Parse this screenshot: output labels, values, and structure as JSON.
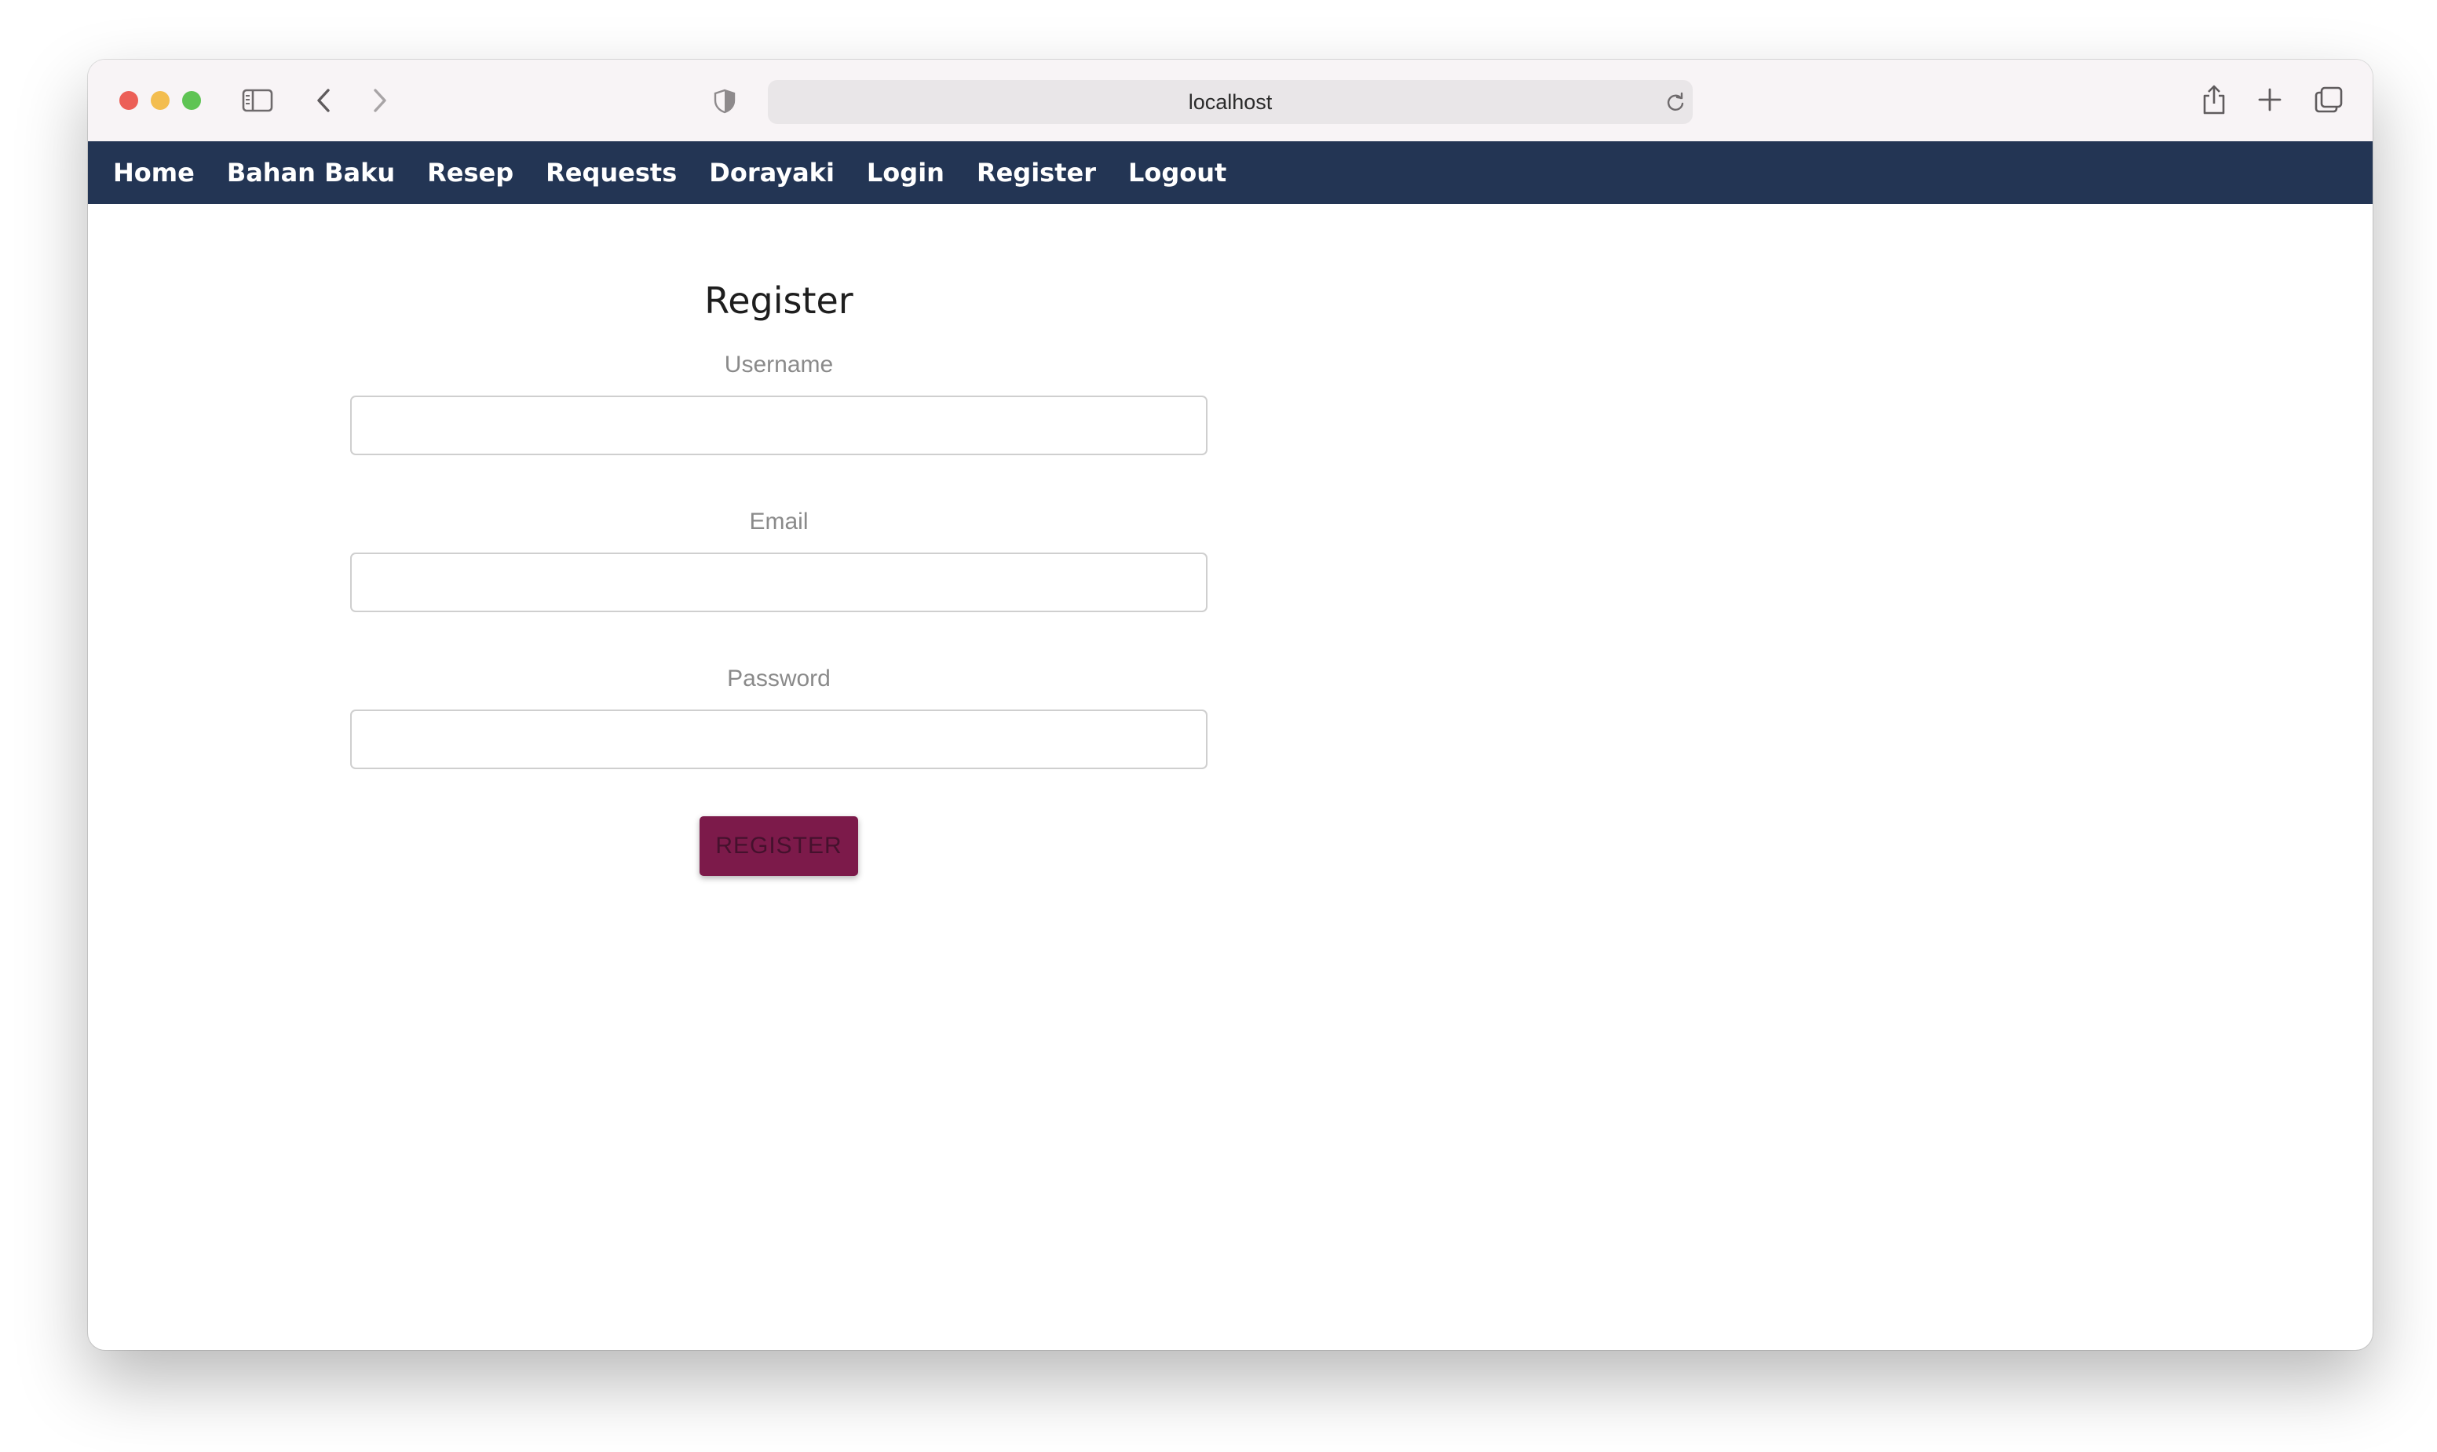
{
  "browser": {
    "address": "localhost"
  },
  "nav": {
    "items": [
      "Home",
      "Bahan Baku",
      "Resep",
      "Requests",
      "Dorayaki",
      "Login",
      "Register",
      "Logout"
    ]
  },
  "form": {
    "title": "Register",
    "username_label": "Username",
    "username_value": "",
    "email_label": "Email",
    "email_value": "",
    "password_label": "Password",
    "password_value": "",
    "submit_label": "REGISTER"
  },
  "colors": {
    "navbar": "#233554",
    "button": "#7c1a4a",
    "titlebar": "#f8f4f6"
  },
  "icons": {
    "titlebar": [
      "sidebar-icon",
      "back-arrow-icon",
      "forward-arrow-icon",
      "shield-icon",
      "reload-icon",
      "share-icon",
      "new-tab-icon",
      "tabs-overview-icon"
    ]
  }
}
